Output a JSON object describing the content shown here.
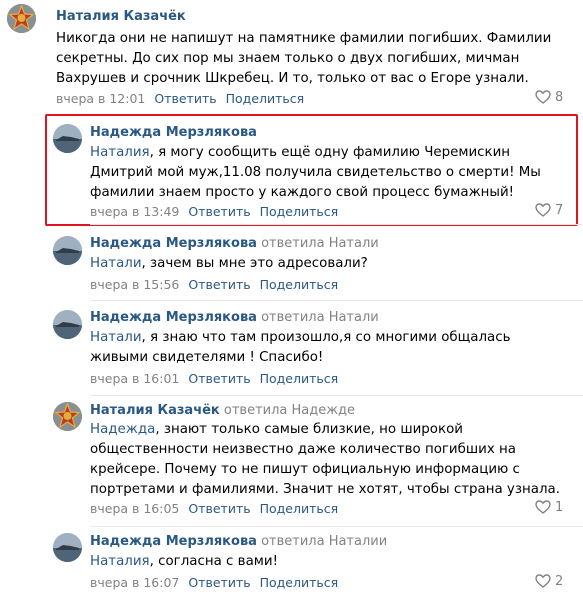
{
  "colors": {
    "link": "#2a5885",
    "muted": "#828282",
    "highlight": "#e0141e"
  },
  "comments": [
    {
      "author": "Наталия Казачёк",
      "reply_to": "",
      "mention": "",
      "text": "Никогда они не напишут на памятнике фамилии погибших. Фамилии секретны. До сих пор мы знаем только о двух погибших, мичман Вахрушев и срочник Шкребец. И то, только от вас о Егоре узнали.",
      "time": "вчера в 12:01",
      "reply_label": "Ответить",
      "share_label": "Поделиться",
      "likes": "8",
      "avatar_icon": "star-medal-avatar"
    },
    {
      "author": "Надежда Мерзлякова",
      "reply_to": "",
      "mention": "Наталия",
      "text": ", я могу сообщить ещё одну фамилию Черемискин Дмитрий мой муж,11.08 получила свидетельство о смерти! Мы фамилии знаем просто у каждого свой процесс бумажный!",
      "time": "вчера в 13:49",
      "reply_label": "Ответить",
      "share_label": "Поделиться",
      "likes": "7",
      "avatar_icon": "sea-photo-avatar"
    },
    {
      "author": "Надежда Мерзлякова",
      "reply_to": "ответила Натали",
      "mention": "Натали",
      "text": ", зачем вы мне это адресовали?",
      "time": "вчера в 15:56",
      "reply_label": "Ответить",
      "share_label": "Поделиться",
      "likes": "",
      "avatar_icon": "sea-photo-avatar"
    },
    {
      "author": "Надежда Мерзлякова",
      "reply_to": "ответила Натали",
      "mention": "Натали",
      "text": ", я знаю что там произошло,я со многими общалась живыми свидетелями ! Спасибо!",
      "time": "вчера в 16:01",
      "reply_label": "Ответить",
      "share_label": "Поделиться",
      "likes": "",
      "avatar_icon": "sea-photo-avatar"
    },
    {
      "author": "Наталия Казачёк",
      "reply_to": "ответила Надежде",
      "mention": "Надежда",
      "text": ", знают только самые близкие, но широкой общественности неизвестно даже количество погибших на крейсере. Почему то не пишут официальную информацию с портретами и фамилиями. Значит не хотят, чтобы страна узнала.",
      "time": "вчера в 16:05",
      "reply_label": "Ответить",
      "share_label": "Поделиться",
      "likes": "1",
      "avatar_icon": "star-medal-avatar"
    },
    {
      "author": "Надежда Мерзлякова",
      "reply_to": "ответила Наталии",
      "mention": "Наталия",
      "text": ", согласна с вами!",
      "time": "вчера в 16:07",
      "reply_label": "Ответить",
      "share_label": "Поделиться",
      "likes": "2",
      "avatar_icon": "sea-photo-avatar"
    }
  ]
}
